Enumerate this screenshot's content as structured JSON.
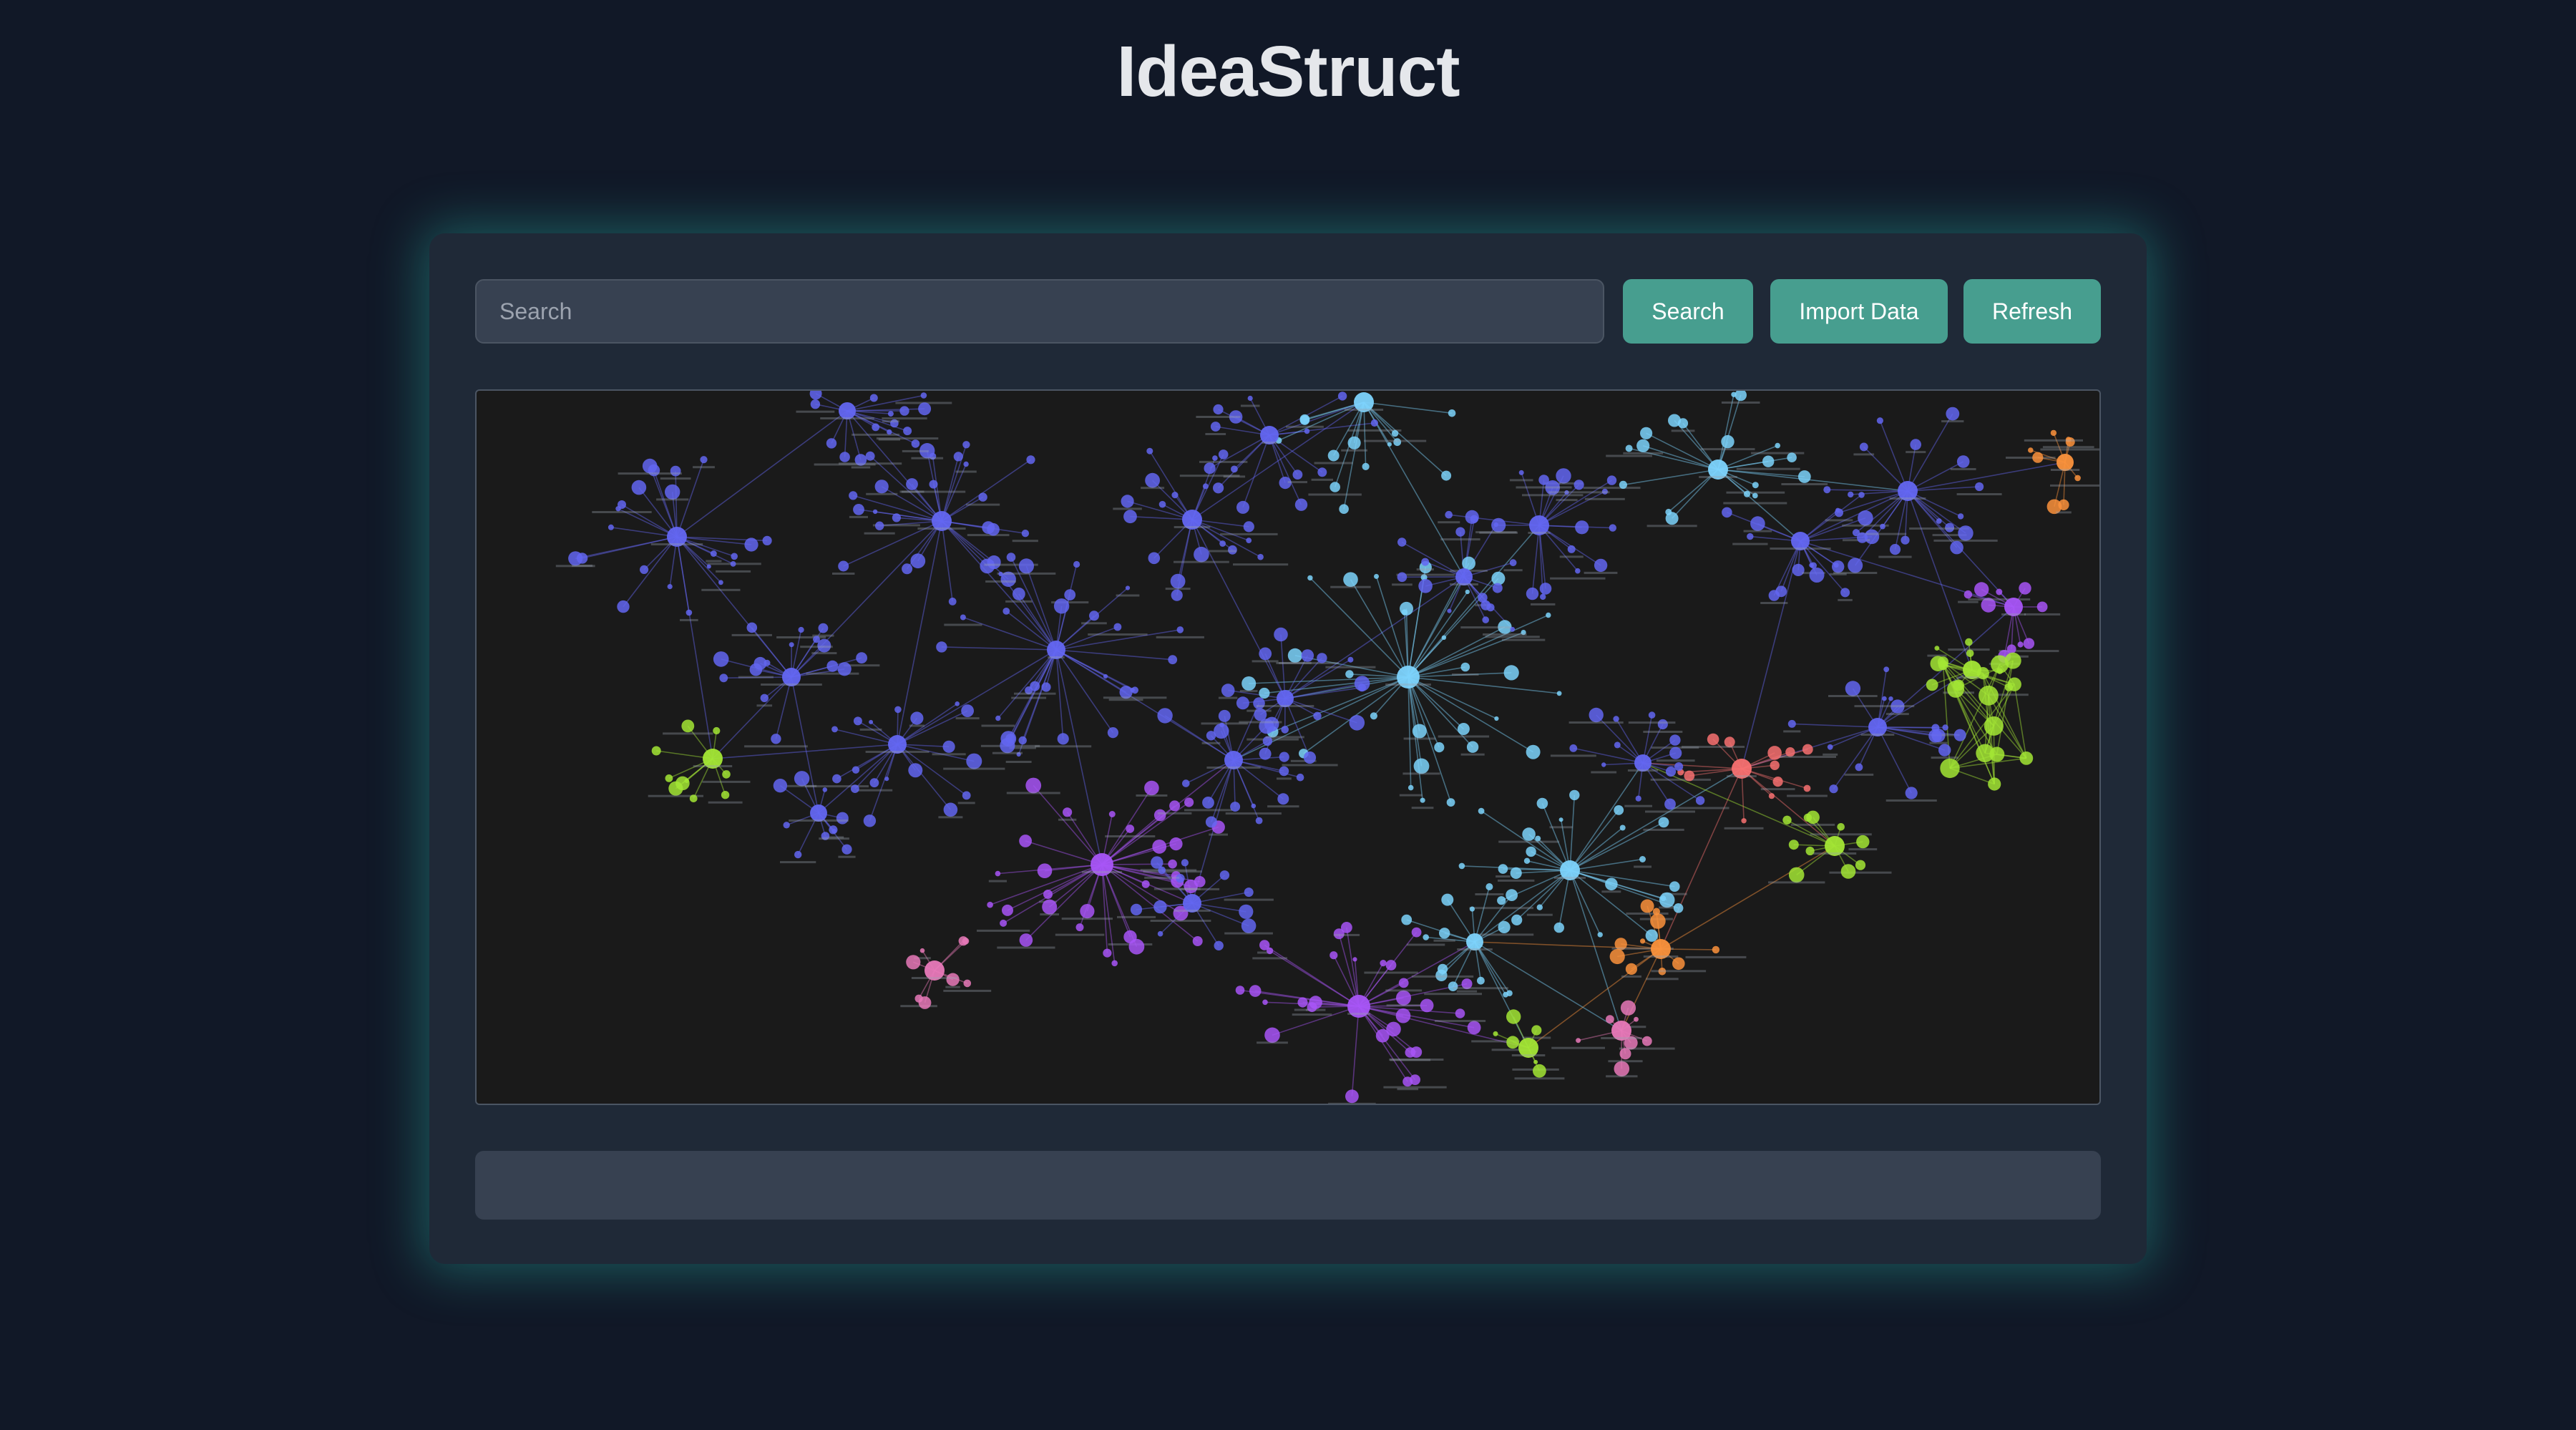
{
  "app": {
    "title": "IdeaStruct"
  },
  "toolbar": {
    "search_placeholder": "Search",
    "search_value": "",
    "search_label": "Search",
    "import_label": "Import Data",
    "refresh_label": "Refresh"
  },
  "graph": {
    "background": "#1a1a1a",
    "cluster_colors": {
      "blue": "#6366f1",
      "cyan": "#7dd3fc",
      "green": "#a3e635",
      "pink": "#e879b9",
      "red": "#f87171",
      "orange": "#fb923c",
      "violet": "#a855f7"
    }
  },
  "status_panel": {
    "text": ""
  },
  "colors": {
    "page_bg": "#111827",
    "card_bg": "#1f2937",
    "accent": "#479e8f",
    "glow": "#2dd4bf"
  }
}
